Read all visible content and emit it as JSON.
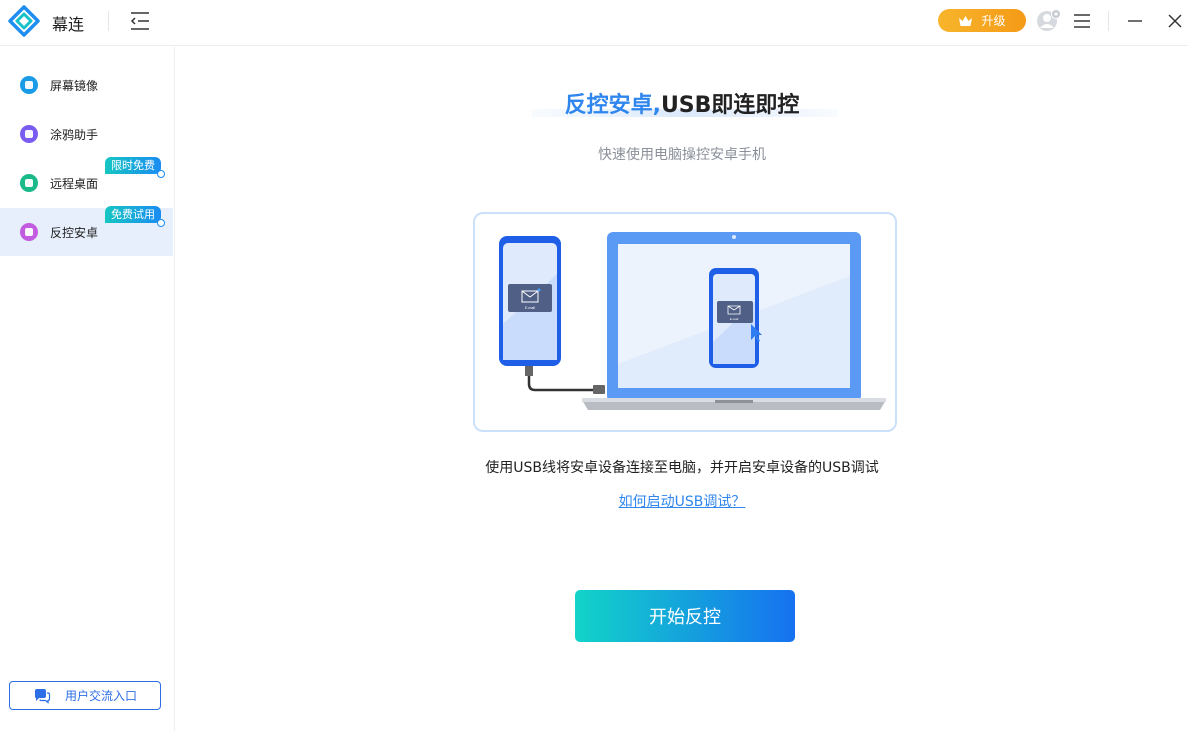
{
  "app": {
    "name": "幕连",
    "upgrade_label": "升级"
  },
  "sidebar": {
    "items": [
      {
        "label": "屏幕镜像",
        "icon": "screen-mirror-icon",
        "color": "#1a9be8",
        "badge": ""
      },
      {
        "label": "涂鸦助手",
        "icon": "graffiti-icon",
        "color": "#7a5cf0",
        "badge": ""
      },
      {
        "label": "远程桌面",
        "icon": "remote-desktop-icon",
        "color": "#19b98a",
        "badge": "限时免费"
      },
      {
        "label": "反控安卓",
        "icon": "reverse-control-icon",
        "color": "#c25ce0",
        "badge": "免费试用",
        "active": true
      }
    ],
    "community_label": "用户交流入口"
  },
  "main": {
    "title_highlight": "反控安卓,",
    "title_rest": "USB即连即控",
    "subtitle": "快速使用电脑操控安卓手机",
    "illustration_email_label": "E-mail",
    "instruction": "使用USB线将安卓设备连接至电脑，并开启安卓设备的USB调试",
    "help_link": "如何启动USB调试？",
    "start_button": "开始反控"
  },
  "colors": {
    "accent": "#2f86ee",
    "active_bg": "#e7effc",
    "upgrade": "#f7a820",
    "button_gradient_start": "#12d4c8",
    "button_gradient_end": "#1671f0"
  }
}
